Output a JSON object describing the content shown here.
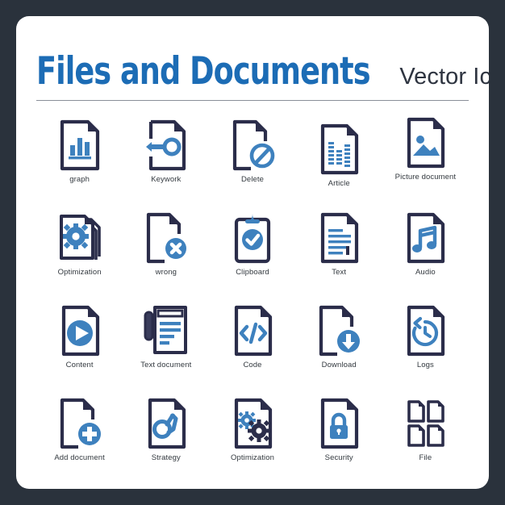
{
  "header": {
    "title_main": "Files and Documents",
    "title_sub": "Vector Icons"
  },
  "colors": {
    "frame": "#2a323c",
    "card": "#ffffff",
    "outline": "#2b2d4a",
    "accent_blue": "#3e81be",
    "title_blue": "#1c6cb5",
    "label": "#33393f",
    "divider": "#8a8f99"
  },
  "icons": [
    {
      "id": "graph",
      "label": "graph",
      "icon": "document-bar-chart-icon"
    },
    {
      "id": "keywork",
      "label": "Keywork",
      "icon": "document-key-icon"
    },
    {
      "id": "delete",
      "label": "Delete",
      "icon": "document-forbidden-icon"
    },
    {
      "id": "article",
      "label": "Article",
      "icon": "document-equalizer-icon"
    },
    {
      "id": "picture",
      "label": "Picture document",
      "icon": "document-image-icon"
    },
    {
      "id": "optimization1",
      "label": "Optimization",
      "icon": "documents-stack-gear-icon"
    },
    {
      "id": "wrong",
      "label": "wrong",
      "icon": "document-cross-icon"
    },
    {
      "id": "clipboard",
      "label": "Clipboard",
      "icon": "clipboard-check-icon"
    },
    {
      "id": "text",
      "label": "Text",
      "icon": "document-lines-icon"
    },
    {
      "id": "audio",
      "label": "Audio",
      "icon": "document-music-note-icon"
    },
    {
      "id": "content",
      "label": "Content",
      "icon": "document-play-icon"
    },
    {
      "id": "textdocument",
      "label": "Text document",
      "icon": "notepad-lines-icon"
    },
    {
      "id": "code",
      "label": "Code",
      "icon": "document-code-icon"
    },
    {
      "id": "download",
      "label": "Download",
      "icon": "document-download-arrow-icon"
    },
    {
      "id": "logs",
      "label": "Logs",
      "icon": "document-clock-icon"
    },
    {
      "id": "adddocument",
      "label": "Add document",
      "icon": "document-plus-icon"
    },
    {
      "id": "strategy",
      "label": "Strategy",
      "icon": "document-knight-icon"
    },
    {
      "id": "optimization2",
      "label": "Optimization",
      "icon": "document-gears-icon"
    },
    {
      "id": "security",
      "label": "Security",
      "icon": "document-lock-icon"
    },
    {
      "id": "file",
      "label": "File",
      "icon": "four-documents-grid-icon"
    }
  ]
}
